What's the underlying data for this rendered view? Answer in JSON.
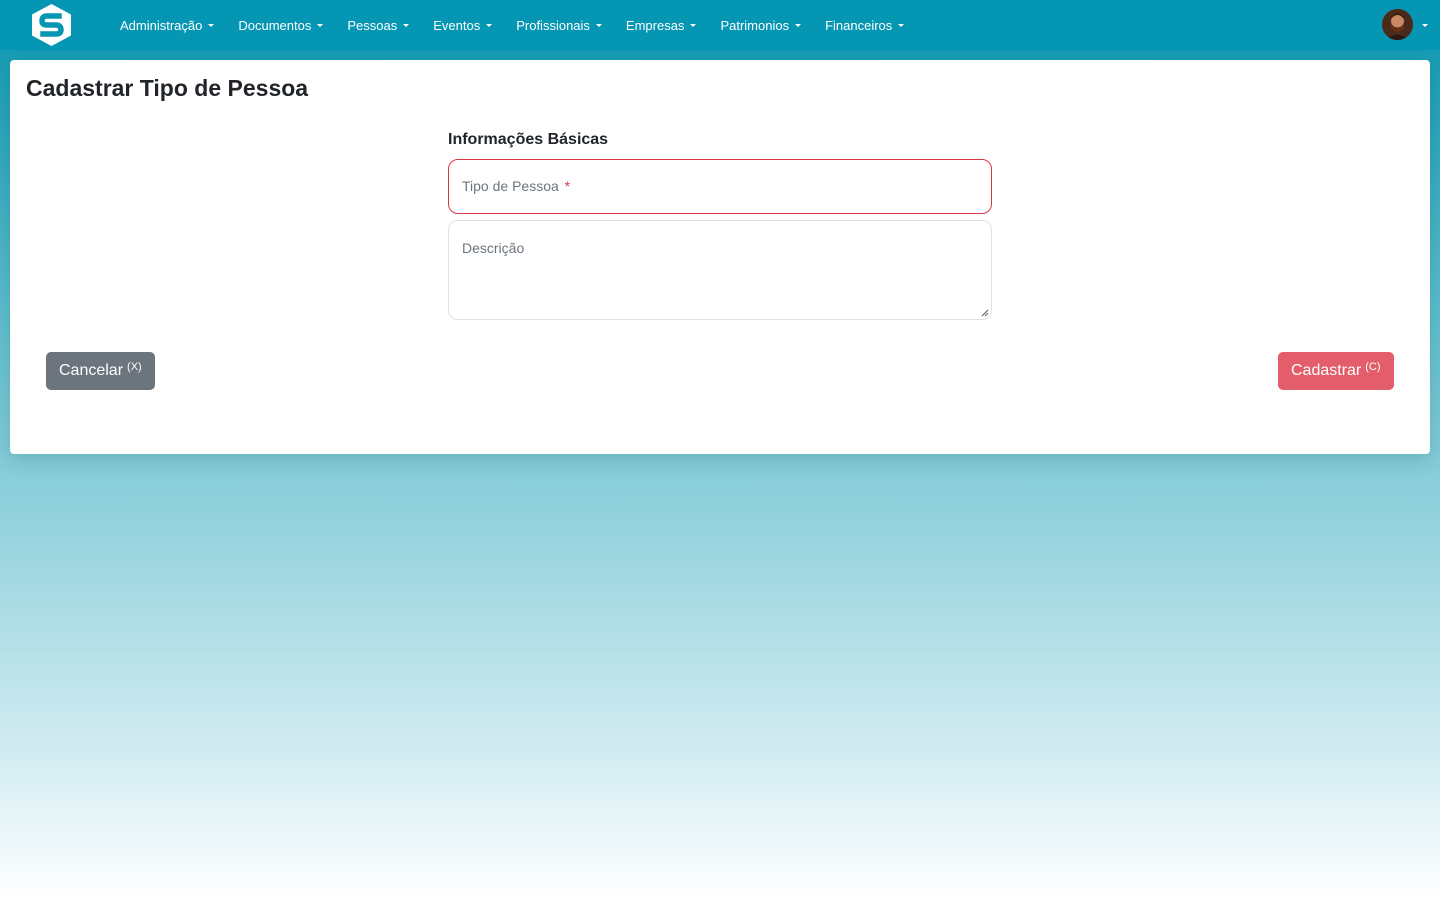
{
  "navbar": {
    "logo_icon": "s-hexagon-logo",
    "menu": [
      {
        "label": "Administração"
      },
      {
        "label": "Documentos"
      },
      {
        "label": "Pessoas"
      },
      {
        "label": "Eventos"
      },
      {
        "label": "Profissionais"
      },
      {
        "label": "Empresas"
      },
      {
        "label": "Patrimonios"
      },
      {
        "label": "Financeiros"
      }
    ],
    "background_color": "#0596b3"
  },
  "page": {
    "title": "Cadastrar Tipo de Pessoa"
  },
  "form": {
    "section_title": "Informações Básicas",
    "tipo_pessoa": {
      "label": "Tipo de Pessoa",
      "required_marker": "*",
      "value": ""
    },
    "descricao": {
      "label": "Descrição",
      "value": ""
    }
  },
  "actions": {
    "cancel_label": "Cancelar",
    "cancel_shortcut": "(X)",
    "submit_label": "Cadastrar",
    "submit_shortcut": "(C)"
  },
  "colors": {
    "accent": "#0596b3",
    "danger": "#dc3545",
    "submit": "#e35d6a",
    "secondary": "#6c757d"
  }
}
